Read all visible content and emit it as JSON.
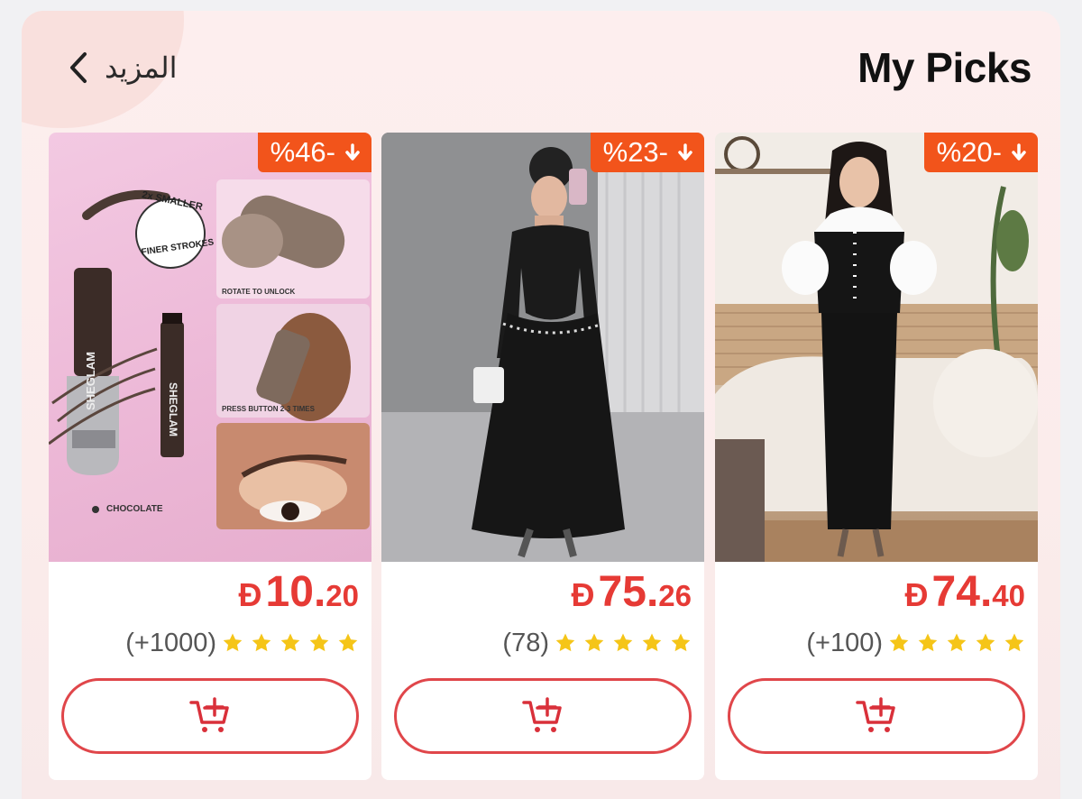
{
  "header": {
    "title": "My Picks",
    "more_label": "المزيد"
  },
  "products": [
    {
      "discount": "%46-",
      "currency": "Đ",
      "price_int": "10.",
      "price_dec": "20",
      "reviews": "(+1000)",
      "stars": 5,
      "image_text": [
        "2x SMALLER",
        "FINER STROKES",
        "ROTATE TO UNLOCK",
        "PRESS BUTTON 2-3 TIMES",
        "CHOCOLATE",
        "SHEGLAM",
        "SHEGLAM"
      ]
    },
    {
      "discount": "%23-",
      "currency": "Đ",
      "price_int": "75.",
      "price_dec": "26",
      "reviews": "(78)",
      "stars": 5
    },
    {
      "discount": "%20-",
      "currency": "Đ",
      "price_int": "74.",
      "price_dec": "40",
      "reviews": "(+100)",
      "stars": 5
    }
  ],
  "colors": {
    "accent": "#e63a35",
    "badge": "#f2541b",
    "star": "#f5c518",
    "button_border": "#e0464a"
  },
  "icons": {
    "more": "chevron-left-icon",
    "badge": "arrow-down-icon",
    "cart": "add-to-cart-icon",
    "rating": "star-icon"
  }
}
